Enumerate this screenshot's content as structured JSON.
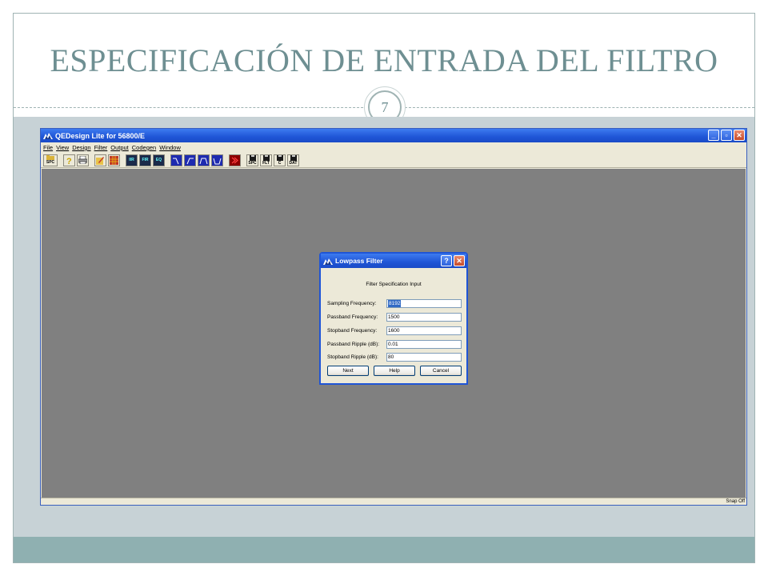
{
  "slide": {
    "title": "ESPECIFICACIÓN DE ENTRADA DEL FILTRO",
    "page_number": "7"
  },
  "app": {
    "title": "QEDesign Lite for 56800/E",
    "window_controls": {
      "minimize": "_",
      "restore": "▫",
      "close": "✕"
    },
    "menu": [
      {
        "label": "File"
      },
      {
        "label": "View"
      },
      {
        "label": "Design"
      },
      {
        "label": "Filter"
      },
      {
        "label": "Output"
      },
      {
        "label": "Codegen"
      },
      {
        "label": "Window"
      }
    ],
    "toolbar": {
      "spc_label": "SPC",
      "iir_label": "IIR",
      "fir_label": "FIR",
      "eq_label": "EQ",
      "spc2_label": "SPC",
      "flt_label": "FLT",
      "c_label": "C",
      "dat_label": "DAT"
    },
    "status": {
      "snap": "Snap Off"
    }
  },
  "dialog": {
    "title": "Lowpass Filter",
    "help_glyph": "?",
    "close_glyph": "✕",
    "heading": "Filter Specification Input",
    "fields": [
      {
        "label": "Sampling Frequency:",
        "value": "8192"
      },
      {
        "label": "Passband Frequency:",
        "value": "1500"
      },
      {
        "label": "Stopband Frequency:",
        "value": "1600"
      },
      {
        "label": "Passband Ripple (dB):",
        "value": "0.01"
      },
      {
        "label": "Stopband Ripple (dB):",
        "value": "80"
      }
    ],
    "buttons": {
      "next": "Next",
      "help": "Help",
      "cancel": "Cancel"
    }
  },
  "colors": {
    "title_text": "#6e8f92",
    "content_band": "#c7d2d6",
    "footer_band": "#8fb0b1",
    "xp_titlebar": "#1f55d6",
    "workspace": "#808080"
  }
}
